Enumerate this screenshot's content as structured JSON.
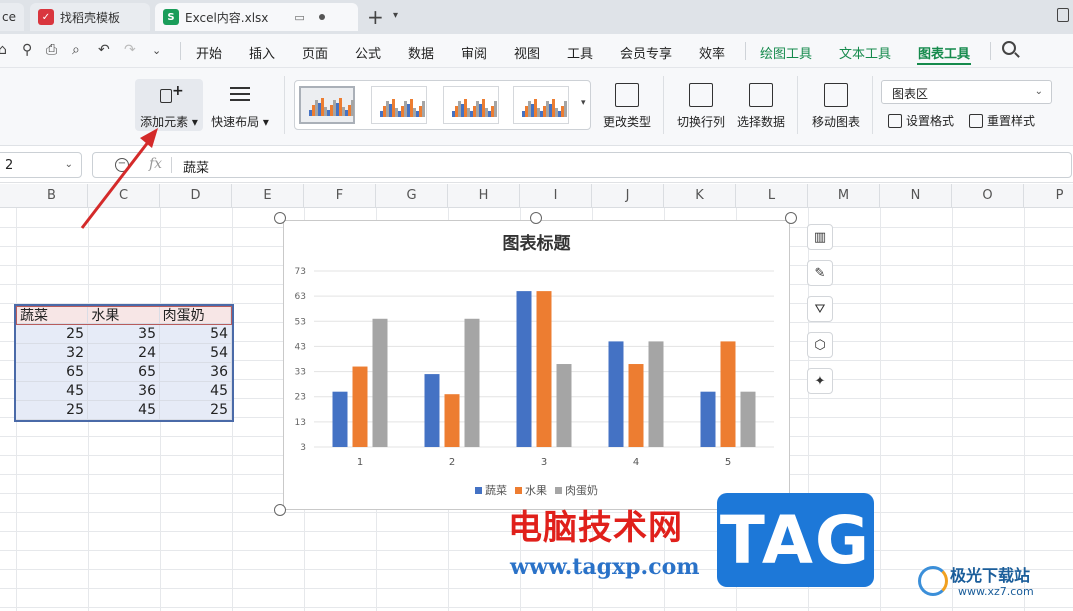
{
  "tabs": [
    {
      "label": "ce",
      "state": "inactive"
    },
    {
      "label": "找稻壳模板",
      "state": "inactive"
    },
    {
      "label": "Excel内容.xlsx",
      "state": "active",
      "badge": "S"
    }
  ],
  "menu": {
    "items": [
      "开始",
      "插入",
      "页面",
      "公式",
      "数据",
      "审阅",
      "视图",
      "工具",
      "会员专享",
      "效率"
    ],
    "context_items": [
      "绘图工具",
      "文本工具",
      "图表工具"
    ],
    "active": "图表工具"
  },
  "ribbon": {
    "add_element": "添加元素",
    "quick_layout": "快速布局",
    "change_type": "更改类型",
    "switch_row_col": "切换行列",
    "select_data": "选择数据",
    "move_chart": "移动图表",
    "chart_area": "图表区",
    "set_format": "设置格式",
    "reset_style": "重置样式"
  },
  "formula_bar": {
    "name_box": "2",
    "fx": "fx",
    "value": "蔬菜"
  },
  "columns": [
    "B",
    "C",
    "D",
    "E",
    "F",
    "G",
    "H",
    "I",
    "J",
    "K",
    "L",
    "M",
    "N",
    "O",
    "P"
  ],
  "table": {
    "headers": [
      "蔬菜",
      "水果",
      "肉蛋奶"
    ],
    "rows": [
      [
        "25",
        "35",
        "54"
      ],
      [
        "32",
        "24",
        "54"
      ],
      [
        "65",
        "65",
        "36"
      ],
      [
        "45",
        "36",
        "45"
      ],
      [
        "25",
        "45",
        "25"
      ]
    ]
  },
  "chart_data": {
    "type": "bar",
    "title": "图表标题",
    "categories": [
      "1",
      "2",
      "3",
      "4",
      "5"
    ],
    "series": [
      {
        "name": "蔬菜",
        "values": [
          25,
          32,
          65,
          45,
          25
        ],
        "color": "#4472c4"
      },
      {
        "name": "水果",
        "values": [
          35,
          24,
          65,
          36,
          45
        ],
        "color": "#ed7d31"
      },
      {
        "name": "肉蛋奶",
        "values": [
          54,
          54,
          36,
          45,
          25
        ],
        "color": "#a5a5a5"
      }
    ],
    "yticks": [
      3,
      13,
      23,
      33,
      43,
      53,
      63,
      73
    ],
    "ylim": [
      3,
      73
    ],
    "legend": "bottom",
    "grid": true
  },
  "watermark": {
    "text": "电脑技术网",
    "url": "www.tagxp.com",
    "tag": "TAG",
    "site": "极光下载站",
    "site_url": "www.xz7.com"
  }
}
